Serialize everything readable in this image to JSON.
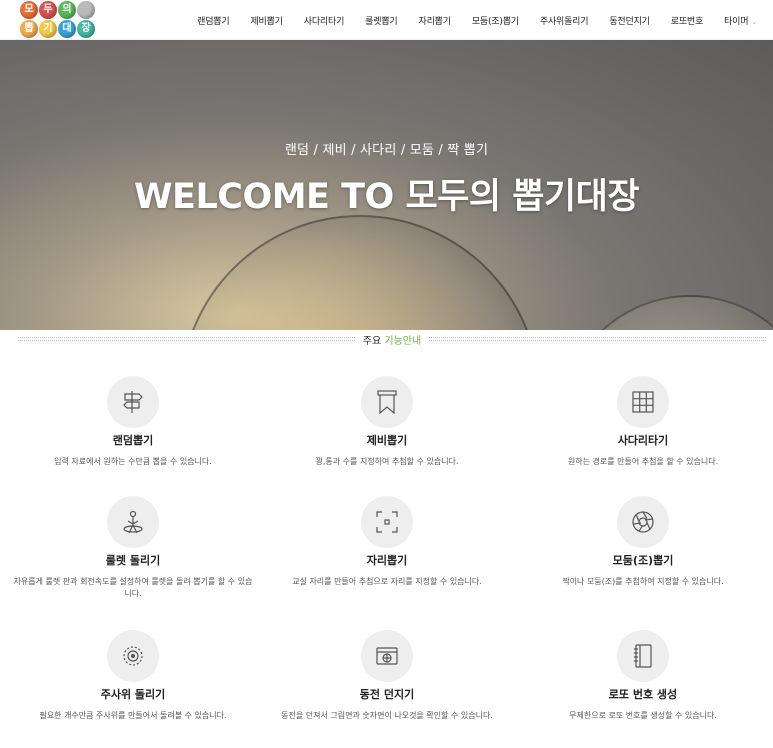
{
  "header": {
    "logo_chars": [
      "모",
      "두",
      "의",
      "뽑",
      "기",
      "대",
      "장"
    ],
    "nav": [
      "랜덤뽑기",
      "제비뽑기",
      "사다리타기",
      "룰렛뽑기",
      "자리뽑기",
      "모둠(조)뽑기",
      "주사위돌리기",
      "동전던지기",
      "로또번호",
      "타이머"
    ]
  },
  "hero": {
    "subtitle": "랜덤 / 제비 / 사다리 / 모둠 / 짝 뽑기",
    "title": "WELCOME TO 모두의 뽑기대장"
  },
  "section": {
    "title_plain": "주요 ",
    "title_highlight": "기능안내",
    "highlight_color": "#6cb33e"
  },
  "features": [
    {
      "icon": "signpost-icon",
      "title": "랜덤뽑기",
      "desc": "입력 자료에서 원하는 수만큼 뽑을 수 있습니다."
    },
    {
      "icon": "bookmark-icon",
      "title": "제비뽑기",
      "desc": "꽝,통과 수를 지정하여 추첨할 수 있습니다."
    },
    {
      "icon": "grid-icon",
      "title": "사다리타기",
      "desc": "원하는 경로를 만들어 추첨을 할 수 있습니다."
    },
    {
      "icon": "roulette-icon",
      "title": "룰렛 돌리기",
      "desc": "자유롭게 룰렛 판과 회전속도를 설정하여 룰렛을 돌려 뽑기를 할 수 있습니다."
    },
    {
      "icon": "seat-frame-icon",
      "title": "자리뽑기",
      "desc": "교실 자리를 만들어 추첨으로 자리를 지정할 수 있습니다."
    },
    {
      "icon": "aperture-icon",
      "title": "모둠(조)뽑기",
      "desc": "짝이나 모둠(조)를 추첨하여 지정할 수 있습니다."
    },
    {
      "icon": "dice-target-icon",
      "title": "주사위 돌리기",
      "desc": "필요한 개수만큼 주사위를 만들어서 돌려볼 수 있습니다."
    },
    {
      "icon": "coin-fan-icon",
      "title": "동전 던지기",
      "desc": "동전을 던져서 그림면과 숫자면이 나오것을 확인할 수 있습니다."
    },
    {
      "icon": "notebook-icon",
      "title": "로또 번호 생성",
      "desc": "무제한으로 로또 번호를 생성할 수 있습니다."
    }
  ]
}
